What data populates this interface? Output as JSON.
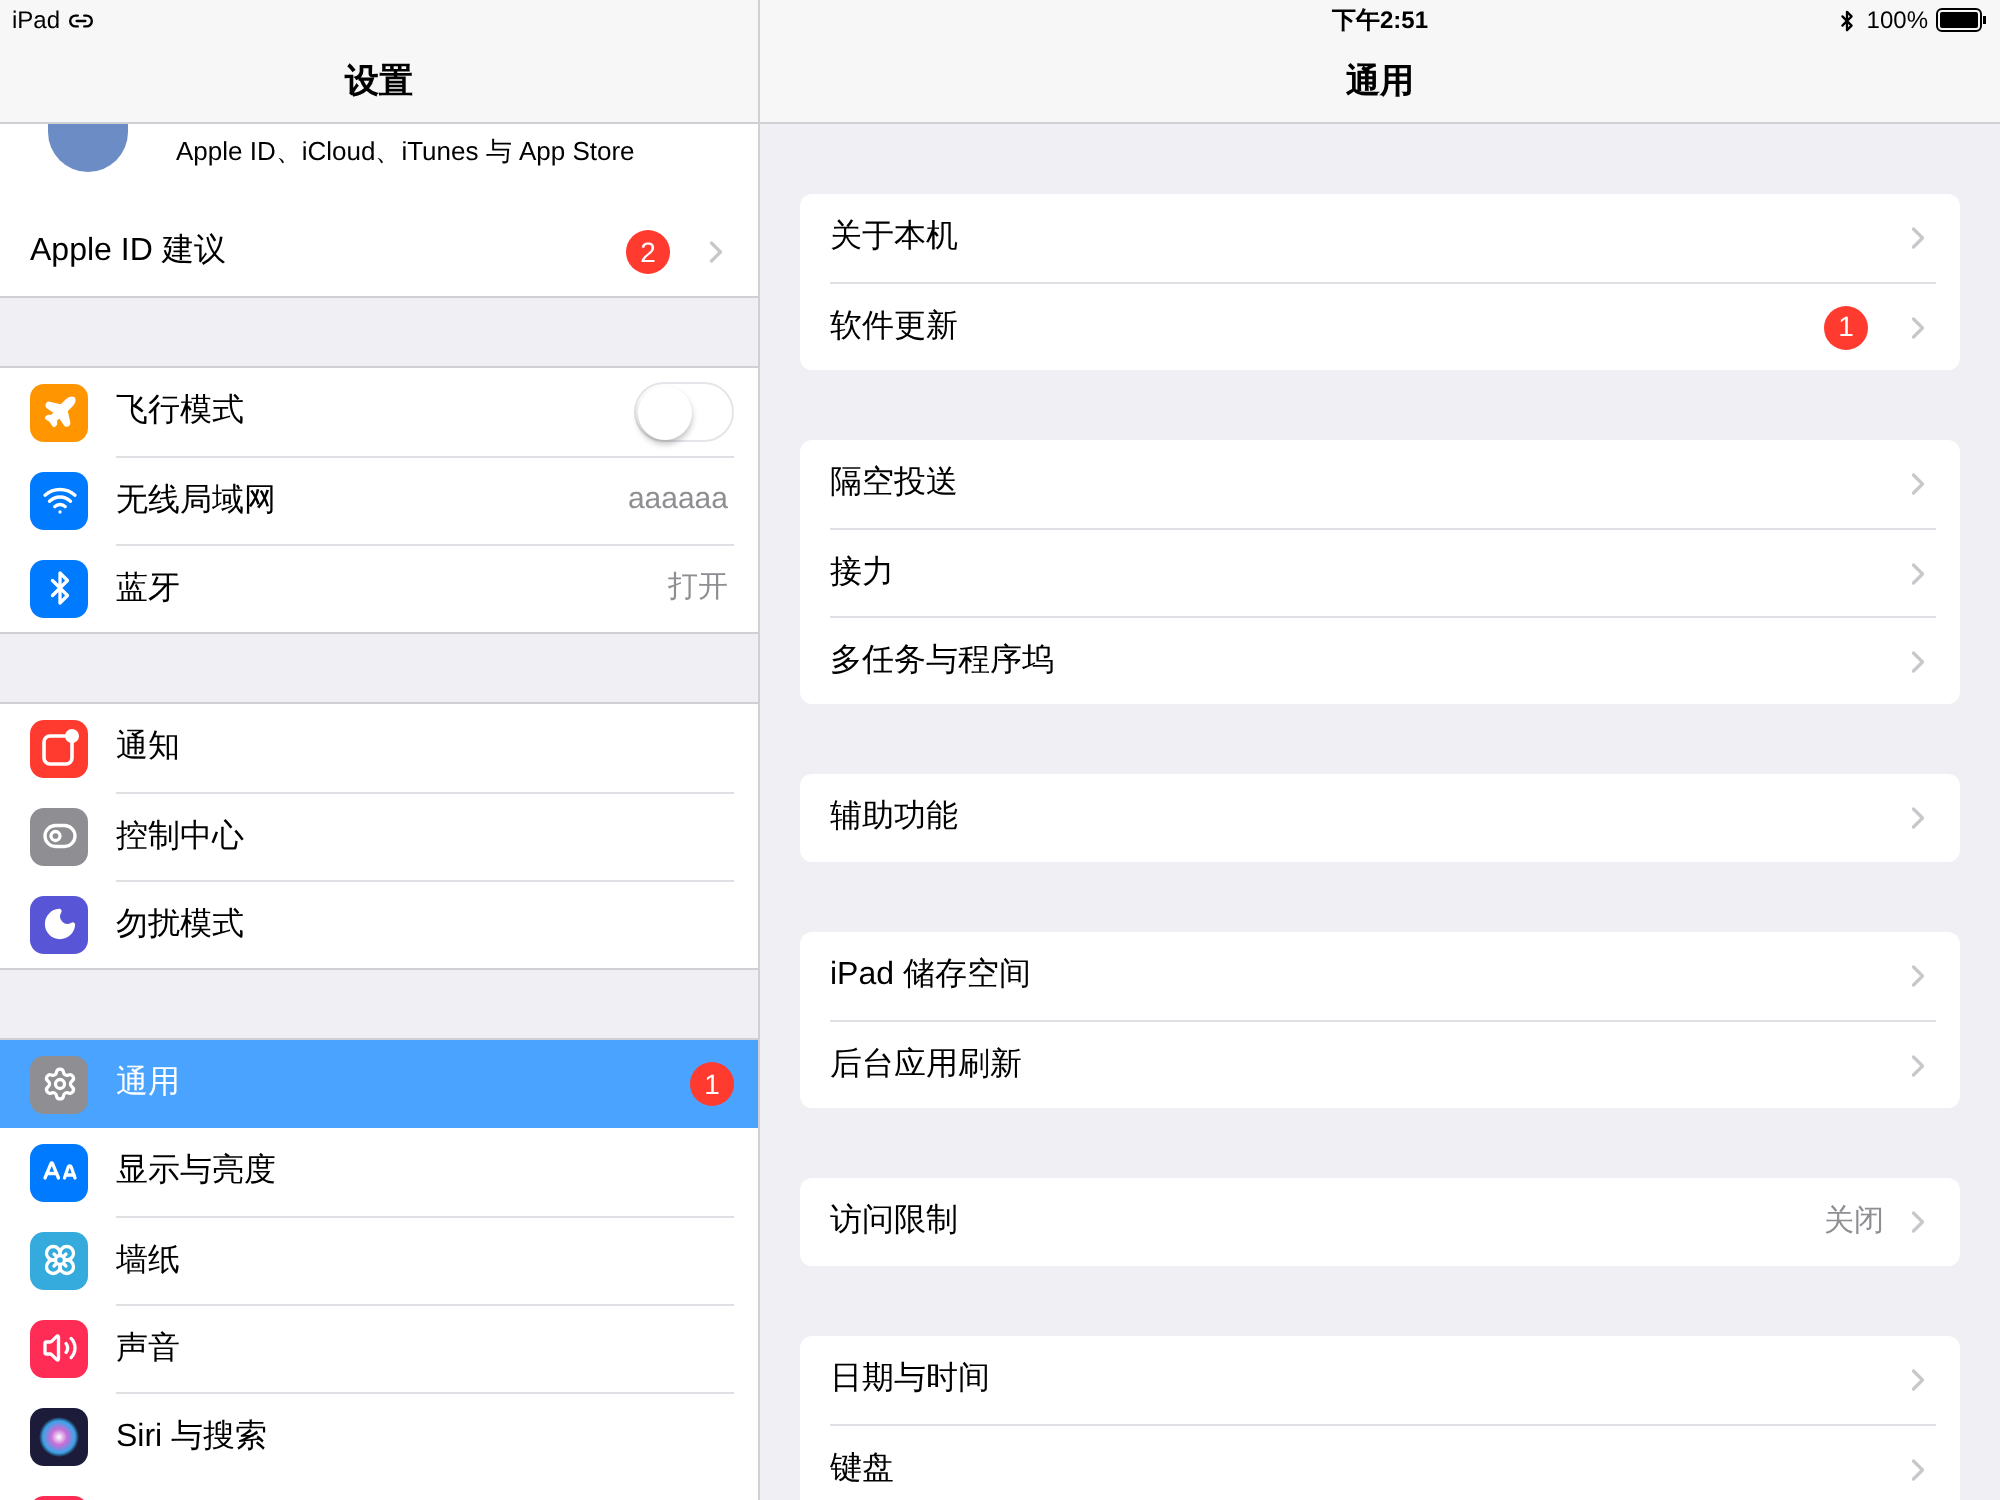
{
  "status_bar": {
    "device": "iPad",
    "time": "下午2:51",
    "battery": "100%"
  },
  "sidebar": {
    "title": "设置",
    "profile": {
      "subtitle": "Apple ID、iCloud、iTunes 与 App Store"
    },
    "groups": [
      [
        {
          "kind": "link",
          "label": "Apple ID 建议",
          "badge": "2",
          "selected": false
        }
      ],
      [
        {
          "kind": "toggle",
          "label": "飞行模式",
          "on": false,
          "selected": false
        },
        {
          "kind": "value",
          "label": "无线局域网",
          "value": "aaaaaa",
          "selected": false
        },
        {
          "kind": "value",
          "label": "蓝牙",
          "value": "打开",
          "selected": false
        }
      ],
      [
        {
          "kind": "plain",
          "label": "通知",
          "selected": false
        },
        {
          "kind": "plain",
          "label": "控制中心",
          "selected": false
        },
        {
          "kind": "plain",
          "label": "勿扰模式",
          "selected": false
        }
      ],
      [
        {
          "kind": "plain",
          "label": "通用",
          "badge": "1",
          "selected": true
        },
        {
          "kind": "plain",
          "label": "显示与亮度",
          "selected": false
        },
        {
          "kind": "plain",
          "label": "墙纸",
          "selected": false
        },
        {
          "kind": "plain",
          "label": "声音",
          "selected": false
        },
        {
          "kind": "plain",
          "label": "Siri 与搜索",
          "selected": false
        }
      ]
    ]
  },
  "detail": {
    "title": "通用",
    "groups": [
      [
        {
          "label": "关于本机"
        },
        {
          "label": "软件更新",
          "badge": "1"
        }
      ],
      [
        {
          "label": "隔空投送"
        },
        {
          "label": "接力"
        },
        {
          "label": "多任务与程序坞"
        }
      ],
      [
        {
          "label": "辅助功能"
        }
      ],
      [
        {
          "label": "iPad 储存空间"
        },
        {
          "label": "后台应用刷新"
        }
      ],
      [
        {
          "label": "访问限制",
          "value": "关闭"
        }
      ],
      [
        {
          "label": "日期与时间"
        },
        {
          "label": "键盘"
        }
      ]
    ]
  }
}
